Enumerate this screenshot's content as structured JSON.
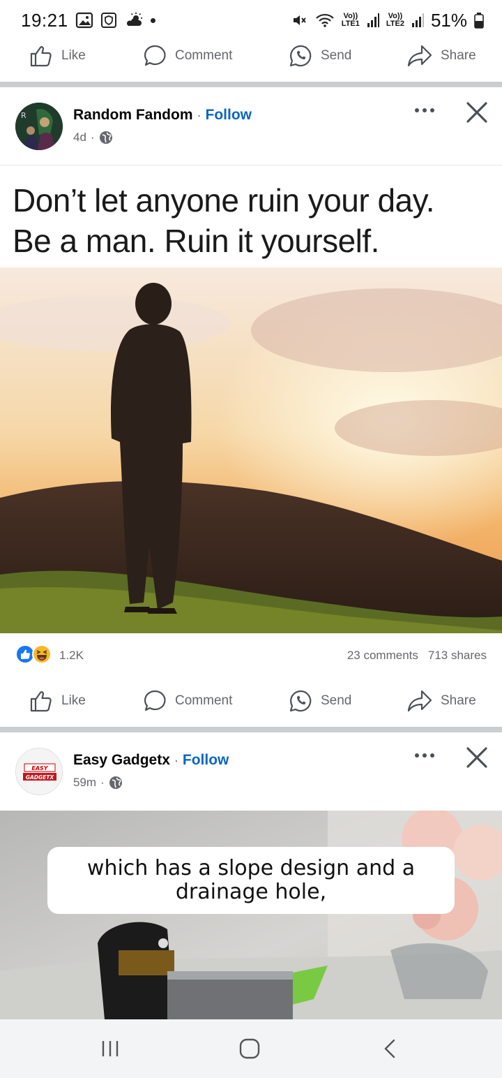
{
  "status_bar": {
    "time": "19:21",
    "battery": "51%",
    "sim1_label_top": "Vo))",
    "sim1_label_bottom": "LTE1",
    "sim2_label_top": "Vo))",
    "sim2_label_bottom": "LTE2",
    "icons": [
      "gallery-icon",
      "shield-app-icon",
      "weather-icon",
      "notification-dot",
      "mute-icon",
      "wifi-icon",
      "signal-icon",
      "battery-icon"
    ]
  },
  "actions": {
    "like": "Like",
    "comment": "Comment",
    "send": "Send",
    "share": "Share"
  },
  "post1": {
    "page_name": "Random Fandom",
    "separator": "·",
    "follow": "Follow",
    "time": "4d",
    "meta_separator": "·",
    "meme_lines": [
      "Don’t let anyone ruin your day.",
      "Be a man. Ruin it yourself."
    ],
    "reaction_count": "1.2K",
    "comments": "23 comments",
    "shares": "713 shares"
  },
  "post2": {
    "page_name": "Easy Gadgetx",
    "separator": "·",
    "follow": "Follow",
    "time": "59m",
    "meta_separator": "·",
    "avatar_text_top": "EASY",
    "avatar_text_bottom": "GADGETX",
    "caption_lines": [
      "which has a slope design and a",
      "drainage hole,"
    ]
  },
  "colors": {
    "accent": "#0a66c2",
    "secondary_text": "#65676b",
    "like_blue": "#1877f2",
    "haha_yellow": "#f7b928"
  }
}
